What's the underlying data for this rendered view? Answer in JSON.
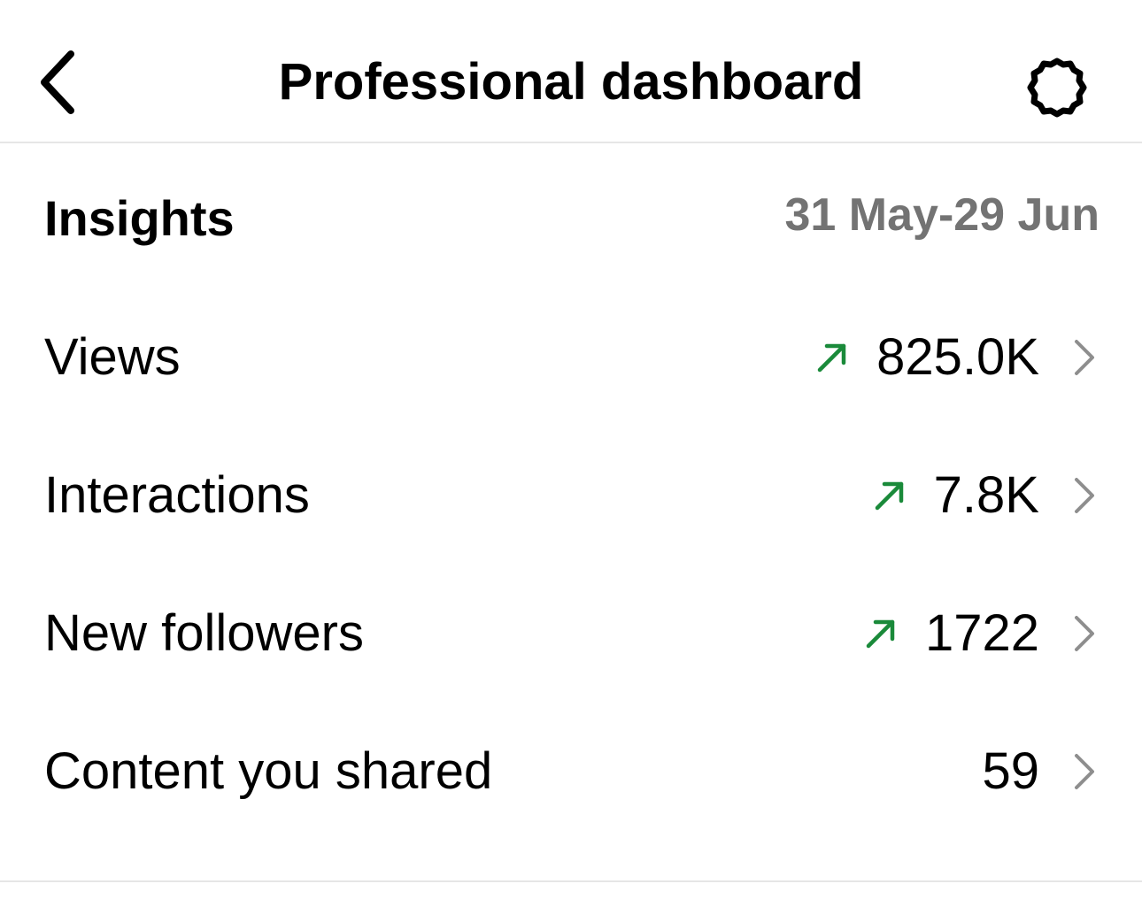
{
  "header": {
    "title": "Professional dashboard",
    "back_icon": "chevron-left-icon",
    "settings_icon": "gear-icon"
  },
  "insights": {
    "title": "Insights",
    "date_range": "31 May-29 Jun"
  },
  "metrics": [
    {
      "label": "Views",
      "value": "825.0K",
      "trend": "up"
    },
    {
      "label": "Interactions",
      "value": "7.8K",
      "trend": "up"
    },
    {
      "label": "New followers",
      "value": "1722",
      "trend": "up"
    },
    {
      "label": "Content you shared",
      "value": "59",
      "trend": "none"
    }
  ],
  "colors": {
    "trend_up": "#1a8a3a",
    "secondary_text": "#737373",
    "chevron": "#8e8e8e",
    "divider": "#e6e6e6"
  }
}
